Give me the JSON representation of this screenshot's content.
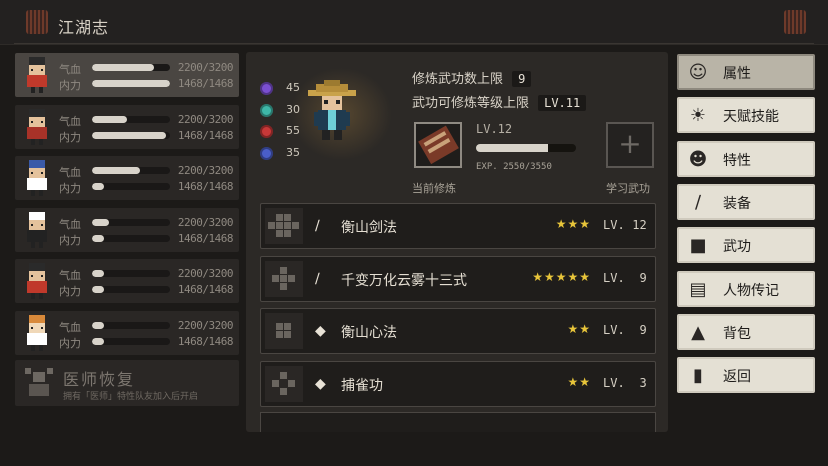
{
  "header": {
    "title": "江湖志"
  },
  "party": [
    {
      "hp_label": "气血",
      "mp_label": "内力",
      "hp": "2200/3200",
      "mp": "1468/1468",
      "hp_frac": 0.8,
      "mp_frac": 1.0
    },
    {
      "hp_label": "气血",
      "mp_label": "内力",
      "hp": "2200/3200",
      "mp": "1468/1468",
      "hp_frac": 0.45,
      "mp_frac": 0.95
    },
    {
      "hp_label": "气血",
      "mp_label": "内力",
      "hp": "2200/3200",
      "mp": "1468/1468",
      "hp_frac": 0.62,
      "mp_frac": 0.16
    },
    {
      "hp_label": "气血",
      "mp_label": "内力",
      "hp": "2200/3200",
      "mp": "1468/1468",
      "hp_frac": 0.22,
      "mp_frac": 0.16
    },
    {
      "hp_label": "气血",
      "mp_label": "内力",
      "hp": "2200/3200",
      "mp": "1468/1468",
      "hp_frac": 0.16,
      "mp_frac": 0.16
    },
    {
      "hp_label": "气血",
      "mp_label": "内力",
      "hp": "2200/3200",
      "mp": "1468/1468",
      "hp_frac": 0.16,
      "mp_frac": 0.16
    }
  ],
  "healer": {
    "title": "医师恢复",
    "subtitle": "拥有「医师」特性队友加入后开启"
  },
  "attributes": [
    {
      "icon": "purple-orb-icon",
      "color": "#7a4fd0",
      "value": "45"
    },
    {
      "icon": "teal-orb-icon",
      "color": "#3fb7a8",
      "value": "30"
    },
    {
      "icon": "red-orb-icon",
      "color": "#c83838",
      "value": "55"
    },
    {
      "icon": "blue-orb-icon",
      "color": "#4a5ec8",
      "value": "35"
    }
  ],
  "info": {
    "limit_label": "修炼武功数上限",
    "limit_value": "9",
    "level_label": "武功可修炼等级上限",
    "level_value": "LV.11"
  },
  "current": {
    "level": "LV.12",
    "exp_label": "EXP. 2550/3550",
    "exp_frac": 0.72,
    "label": "当前修炼"
  },
  "learn": {
    "label": "学习武功",
    "plus": "+"
  },
  "skills": [
    {
      "name": "衡山剑法",
      "type_icon": "sword-icon",
      "type_glyph": "∕",
      "stars": "★★★",
      "lv_prefix": "LV.",
      "lv": "12"
    },
    {
      "name": "千变万化云雾十三式",
      "type_icon": "sword-icon",
      "type_glyph": "∕",
      "stars": "★★★★★",
      "lv_prefix": "LV.",
      "lv": "9"
    },
    {
      "name": "衡山心法",
      "type_icon": "scroll-icon",
      "type_glyph": "◆",
      "stars": "★★",
      "lv_prefix": "LV.",
      "lv": "9"
    },
    {
      "name": "捕雀功",
      "type_icon": "scroll-icon",
      "type_glyph": "◆",
      "stars": "★★",
      "lv_prefix": "LV.",
      "lv": "3"
    }
  ],
  "menu": [
    {
      "label": "属性",
      "icon": "person-icon",
      "glyph": "☺"
    },
    {
      "label": "天赋技能",
      "icon": "talent-icon",
      "glyph": "☀"
    },
    {
      "label": "特性",
      "icon": "trait-icon",
      "glyph": "☻"
    },
    {
      "label": "装备",
      "icon": "sword-icon",
      "glyph": "∕"
    },
    {
      "label": "武功",
      "icon": "book-icon",
      "glyph": "■"
    },
    {
      "label": "人物传记",
      "icon": "biography-icon",
      "glyph": "▤"
    },
    {
      "label": "背包",
      "icon": "bag-icon",
      "glyph": "▲"
    },
    {
      "label": "返回",
      "icon": "return-icon",
      "glyph": "▮"
    }
  ]
}
